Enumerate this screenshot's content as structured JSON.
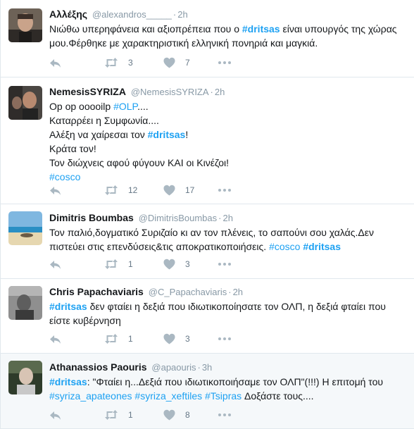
{
  "tweets": [
    {
      "fullname": "Αλλέξης",
      "username": "@alexandros_____",
      "time": "2h",
      "lines": [
        [
          {
            "t": "Νιώθω υπερηφάνεια και αξιοπρέπεια που ο "
          },
          {
            "t": "#dritsas",
            "h": true,
            "b": true
          },
          {
            "t": " είναι υπουργός της χώρας"
          }
        ],
        [
          {
            "t": "μου.Φέρθηκε με χαρακτηριστική ελληνική πονηριά και μαγκιά."
          }
        ]
      ],
      "retweets": "3",
      "likes": "7"
    },
    {
      "fullname": "NemesisSYRIZA",
      "username": "@NemesisSYRIZA",
      "time": "2h",
      "lines": [
        [
          {
            "t": "Op op ooooilp "
          },
          {
            "t": "#OLP",
            "h": true
          },
          {
            "t": "...."
          }
        ],
        [
          {
            "t": "Καταρρέει η Συμφωνία...."
          }
        ],
        [
          {
            "t": "Αλέξη να χαίρεσαι τον "
          },
          {
            "t": "#dritsas",
            "h": true,
            "b": true
          },
          {
            "t": "!"
          }
        ],
        [
          {
            "t": "Κράτα τον!"
          }
        ],
        [
          {
            "t": "Τον διώχνεις αφού φύγουν ΚΑΙ οι Κινέζοι!"
          }
        ],
        [
          {
            "t": "#cosco",
            "h": true
          }
        ]
      ],
      "retweets": "12",
      "likes": "17"
    },
    {
      "fullname": "Dimitris Boumbas",
      "username": "@DimitrisBoumbas",
      "time": "2h",
      "lines": [
        [
          {
            "t": "Τον παλιό,δογματικό Συριζαίο κι αν τον πλένεις, το σαπούνι σου χαλάς.Δεν"
          }
        ],
        [
          {
            "t": "πιστεύει στις επενδύσεις&τις αποκρατικοποιήσεις. "
          },
          {
            "t": "#cosco",
            "h": true
          },
          {
            "t": " "
          },
          {
            "t": "#dritsas",
            "h": true,
            "b": true
          }
        ]
      ],
      "retweets": "1",
      "likes": "3"
    },
    {
      "fullname": "Chris Papachaviaris",
      "username": "@C_Papachaviaris",
      "time": "2h",
      "lines": [
        [
          {
            "t": "#dritsas",
            "h": true,
            "b": true
          },
          {
            "t": " δεν φταίει η δεξιά που ιδιωτικοποίησατε τον ΟΛΠ, η δεξιά φταίει που"
          }
        ],
        [
          {
            "t": "είστε κυβέρνηση"
          }
        ]
      ],
      "retweets": "1",
      "likes": "3"
    },
    {
      "fullname": "Athanassios Paouris",
      "username": "@apaouris",
      "time": "3h",
      "lines": [
        [
          {
            "t": "#dritsas",
            "h": true,
            "b": true
          },
          {
            "t": ": \"Φταίει η...Δεξιά που ιδιωτικοποιήσαμε τον ΟΛΠ\"(!!!) Η επιτομή του"
          }
        ],
        [
          {
            "t": "#syriza_apateones",
            "h": true
          },
          {
            "t": " "
          },
          {
            "t": "#syriza_xeftiles",
            "h": true
          },
          {
            "t": " "
          },
          {
            "t": "#Tsipras",
            "h": true
          },
          {
            "t": " Δοξάστε τους...."
          }
        ]
      ],
      "retweets": "1",
      "likes": "8"
    }
  ],
  "icons": {
    "reply": "reply-icon",
    "retweet": "retweet-icon",
    "like": "heart-icon",
    "more": "more-icon"
  },
  "colors": {
    "hashtag": "#1da1f2",
    "meta": "#8899a6",
    "action": "#aab8c2",
    "border": "#e1e8ed",
    "highlight_bg": "#f5f8fa"
  }
}
